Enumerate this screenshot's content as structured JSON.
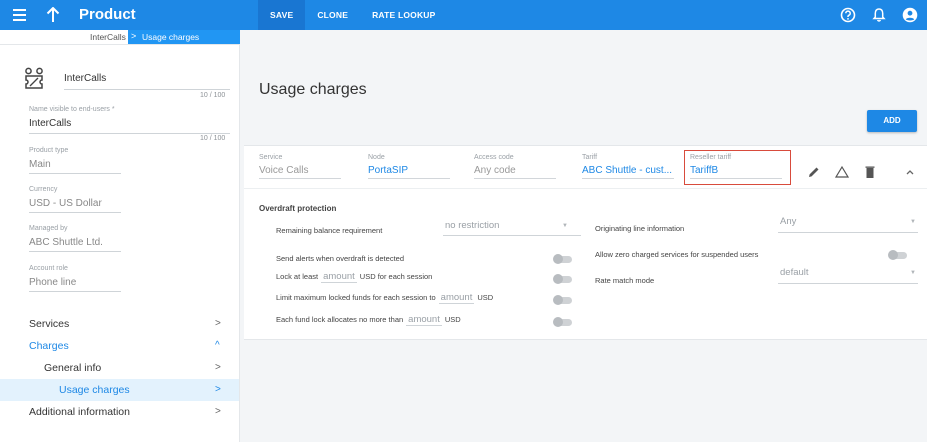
{
  "topbar": {
    "title": "Product",
    "actions": [
      "SAVE",
      "CLONE",
      "RATE LOOKUP"
    ],
    "icons": [
      "menu-icon",
      "arrow-up-icon",
      "help-icon",
      "bell-icon",
      "account-icon"
    ],
    "color": "#1e88e5"
  },
  "breadcrumb": {
    "items": [
      "InterCalls",
      "Usage charges"
    ],
    "separator": ">"
  },
  "product": {
    "name": "InterCalls",
    "name_counter": "10 / 100",
    "visible_name_label": "Name visible to end-users *",
    "visible_name_value": "InterCalls",
    "visible_name_counter": "10 / 100",
    "type_label": "Product type",
    "type_value": "Main",
    "currency_label": "Currency",
    "currency_value": "USD - US Dollar",
    "managed_by_label": "Managed by",
    "managed_by_value": "ABC Shuttle Ltd.",
    "account_role_label": "Account role",
    "account_role_value": "Phone line"
  },
  "nav": {
    "items": [
      {
        "label": "Services",
        "chevron": ">"
      },
      {
        "label": "Charges",
        "chevron": "^"
      },
      {
        "label": "General info",
        "chevron": ">"
      },
      {
        "label": "Usage charges",
        "chevron": ">"
      },
      {
        "label": "Additional information",
        "chevron": ">"
      }
    ]
  },
  "main": {
    "title": "Usage charges",
    "add_label": "ADD"
  },
  "charge_row": {
    "service_label": "Service",
    "service_value": "Voice Calls",
    "node_label": "Node",
    "node_value": "PortaSIP",
    "access_code_label": "Access code",
    "access_code_value": "Any code",
    "tariff_label": "Tariff",
    "tariff_value": "ABC Shuttle - cust...",
    "reseller_tariff_label": "Reseller tariff",
    "reseller_tariff_value": "TariffB",
    "icons": [
      "edit-icon",
      "warning-icon",
      "delete-icon",
      "chevron-up-icon"
    ]
  },
  "overdraft": {
    "title": "Overdraft protection",
    "remaining_label": "Remaining balance requirement",
    "remaining_value": "no restriction",
    "send_alerts_label": "Send alerts when overdraft is detected",
    "lock_prefix": "Lock at least",
    "lock_placeholder": "amount",
    "lock_suffix": "USD for each session",
    "limit_prefix": "Limit maximum locked funds for each session to",
    "limit_placeholder": "amount",
    "limit_suffix": "USD",
    "each_prefix": "Each fund lock allocates no more than",
    "each_placeholder": "amount",
    "each_suffix": "USD",
    "originating_label": "Originating line information",
    "originating_value": "Any",
    "allow_zero_label": "Allow zero charged services for suspended users",
    "rate_match_label": "Rate match mode",
    "rate_match_value": "default"
  }
}
